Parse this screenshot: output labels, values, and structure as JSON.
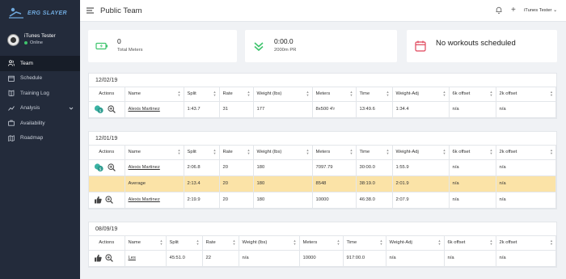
{
  "brand": {
    "name": "ERG SLAYER"
  },
  "user": {
    "name": "iTunes Tester",
    "status": "Online"
  },
  "sidebar": {
    "items": [
      {
        "label": "Team",
        "icon": "users-icon",
        "active": true
      },
      {
        "label": "Schedule",
        "icon": "calendar-icon"
      },
      {
        "label": "Training Log",
        "icon": "book-icon"
      },
      {
        "label": "Analysis",
        "icon": "chart-line-icon",
        "chevron": true
      },
      {
        "label": "Availability",
        "icon": "briefcase-icon"
      },
      {
        "label": "Roadmap",
        "icon": "map-icon"
      }
    ]
  },
  "topbar": {
    "title": "Public Team",
    "user_label": "iTunes Tester"
  },
  "stats": [
    {
      "value": "0",
      "label": "Total Meters",
      "icon": "battery-charging-icon",
      "color": "#3ec46d"
    },
    {
      "value": "0:00.0",
      "label": "2000m PR",
      "icon": "chevron-double-down-icon",
      "color": "#3ec46d"
    },
    {
      "value": "No workouts scheduled",
      "label": "",
      "icon": "calendar-icon",
      "color": "#e0455a"
    }
  ],
  "columns": [
    "Actions",
    "Name",
    "Split",
    "Rate",
    "Weight (lbs)",
    "Meters",
    "Time",
    "Weight-Adj",
    "6k offset",
    "2k offset"
  ],
  "groups": [
    {
      "date": "12/02/19",
      "rows": [
        {
          "action_icon": "coin-icon",
          "name": "Alexis Martinez",
          "split": "1:43.7",
          "rate": "31",
          "weight": "177",
          "meters": "8x500 4'r",
          "time": "13:49.6",
          "adj": "1:34.4",
          "k6": "n/a",
          "k2": "n/a"
        }
      ]
    },
    {
      "date": "12/01/19",
      "rows": [
        {
          "action_icon": "coin-icon",
          "name": "Alexis Martinez",
          "split": "2:06.8",
          "rate": "20",
          "weight": "180",
          "meters": "7097.79",
          "time": "30:00.0",
          "adj": "1:55.9",
          "k6": "n/a",
          "k2": "n/a"
        },
        {
          "avg": true,
          "name": "Average",
          "split": "2:13.4",
          "rate": "20",
          "weight": "180",
          "meters": "8548",
          "time": "38:19.0",
          "adj": "2:01.9",
          "k6": "n/a",
          "k2": "n/a"
        },
        {
          "action_icon": "thumbs-up-icon",
          "name": "Alexis Martinez",
          "split": "2:19.9",
          "rate": "20",
          "weight": "180",
          "meters": "10000",
          "time": "46:38.0",
          "adj": "2:07.9",
          "k6": "n/a",
          "k2": "n/a"
        }
      ]
    },
    {
      "date": "08/09/19",
      "rows": [
        {
          "action_icon": "thumbs-up-icon",
          "name": "Les",
          "split": "45:51.0",
          "rate": "22",
          "weight": "n/a",
          "meters": "10000",
          "time": "917:00.0",
          "adj": "n/a",
          "k6": "n/a",
          "k2": "n/a"
        }
      ]
    }
  ]
}
